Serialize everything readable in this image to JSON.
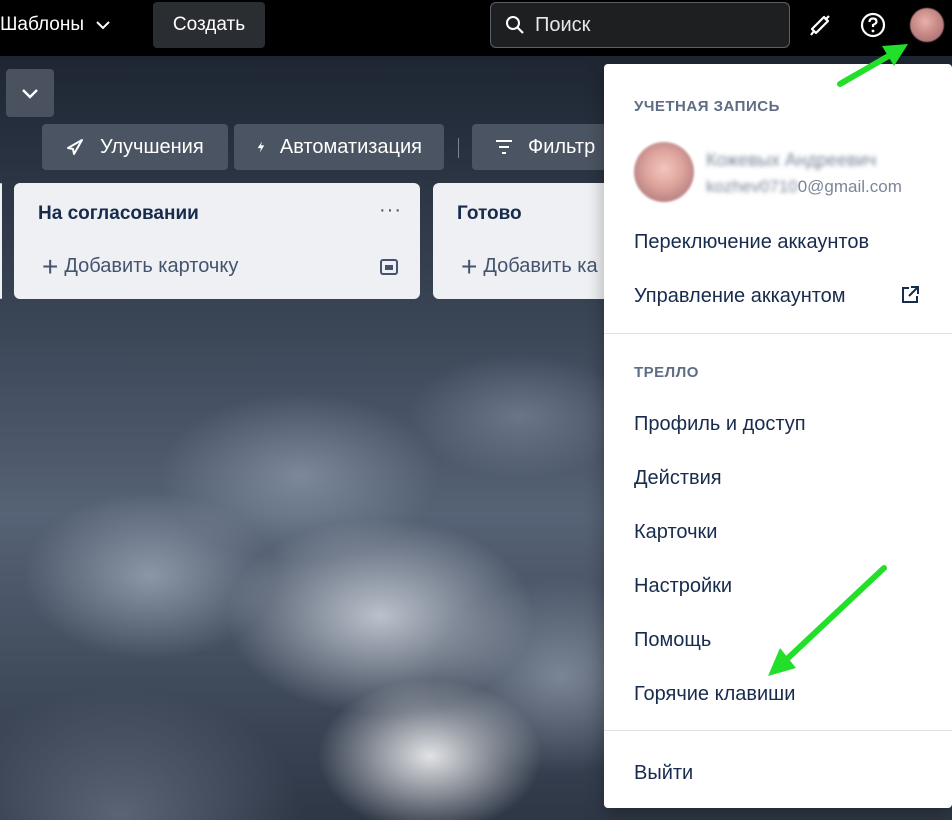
{
  "topbar": {
    "templates_label": "Шаблоны",
    "create_label": "Создать",
    "search_placeholder": "Поиск"
  },
  "board_header": {
    "buttons": [
      "Улучшения",
      "Автоматизация",
      "Фильтр"
    ]
  },
  "lists": [
    {
      "title": "На согласовании",
      "add_label": "Добавить карточку",
      "menu": "···"
    },
    {
      "title": "Готово",
      "add_label": "Добавить ка"
    }
  ],
  "account_menu": {
    "section_account": "УЧЕТНАЯ ЗАПИСЬ",
    "user_name": "Кожевых Андреевич",
    "email_prefix": "kozhev0710",
    "email_suffix": "0@gmail.com",
    "switch_accounts": "Переключение аккаунтов",
    "manage_account": "Управление аккаунтом",
    "section_trello": "ТРЕЛЛО",
    "items": [
      "Профиль и доступ",
      "Действия",
      "Карточки",
      "Настройки",
      "Помощь",
      "Горячие клавиши"
    ],
    "logout": "Выйти"
  },
  "colors": {
    "topbar_bg": "#000000",
    "annotation_arrow": "#22e02a",
    "menu_text": "#172b4d"
  }
}
